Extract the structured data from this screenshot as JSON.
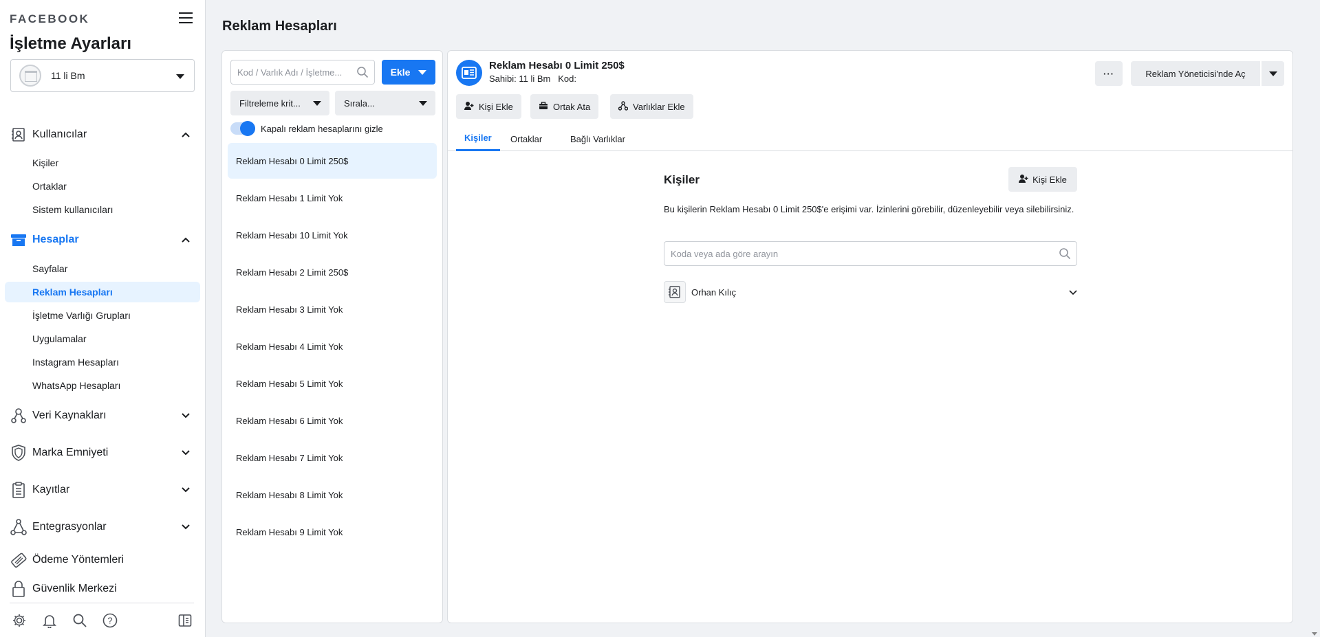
{
  "sidebar": {
    "brand": "FACEBOOK",
    "title": "İşletme Ayarları",
    "business_name": "11 li Bm",
    "sections": {
      "users": {
        "label": "Kullanıcılar",
        "items": [
          "Kişiler",
          "Ortaklar",
          "Sistem kullanıcıları"
        ]
      },
      "accounts": {
        "label": "Hesaplar",
        "items": [
          "Sayfalar",
          "Reklam Hesapları",
          "İşletme Varlığı Grupları",
          "Uygulamalar",
          "Instagram Hesapları",
          "WhatsApp Hesapları"
        ]
      },
      "data_sources": {
        "label": "Veri Kaynakları"
      },
      "brand_safety": {
        "label": "Marka Emniyeti"
      },
      "logs": {
        "label": "Kayıtlar"
      },
      "integrations": {
        "label": "Entegrasyonlar"
      },
      "payments": {
        "label": "Ödeme Yöntemleri"
      },
      "security": {
        "label": "Güvenlik Merkezi"
      }
    },
    "footer_icons": [
      "gear-icon",
      "bell-icon",
      "search-icon",
      "help-icon",
      "panel-toggle-icon"
    ]
  },
  "page": {
    "title": "Reklam Hesapları"
  },
  "list": {
    "search_placeholder": "Kod / Varlık Adı / İşletme...",
    "add_label": "Ekle",
    "filter_label": "Filtreleme krit...",
    "sort_label": "Sırala...",
    "toggle_label": "Kapalı reklam hesaplarını gizle",
    "items": [
      "Reklam Hesabı 0 Limit 250$",
      "Reklam Hesabı 1 Limit Yok",
      "Reklam Hesabı 10 Limit Yok",
      "Reklam Hesabı 2 Limit 250$",
      "Reklam Hesabı 3 Limit Yok",
      "Reklam Hesabı 4 Limit Yok",
      "Reklam Hesabı 5 Limit Yok",
      "Reklam Hesabı 6 Limit Yok",
      "Reklam Hesabı 7 Limit Yok",
      "Reklam Hesabı 8 Limit Yok",
      "Reklam Hesabı 9 Limit Yok"
    ]
  },
  "detail": {
    "title": "Reklam Hesabı 0 Limit 250$",
    "subtitle": "Sahibi: 11 li Bm   Kod:",
    "more_label": "···",
    "open_label": "Reklam Yöneticisi'nde Aç",
    "actions": {
      "add_person": "Kişi Ekle",
      "assign_partner": "Ortak Ata",
      "add_assets": "Varlıklar Ekle"
    },
    "tabs": [
      "Kişiler",
      "Ortaklar",
      "Bağlı Varlıklar"
    ],
    "people": {
      "title": "Kişiler",
      "add_label": "Kişi Ekle",
      "description": "Bu kişilerin Reklam Hesabı 0 Limit 250$'e erişimi var. İzinlerini görebilir, düzenleyebilir veya silebilirsiniz.",
      "search_placeholder": "Koda veya ada göre arayın",
      "rows": [
        {
          "name": "Orhan Kılıç"
        }
      ]
    }
  },
  "colors": {
    "accent": "#1877f2",
    "selected_bg": "#e7f3ff",
    "button_bg": "#ebedf0",
    "page_bg": "#f0f2f5"
  }
}
